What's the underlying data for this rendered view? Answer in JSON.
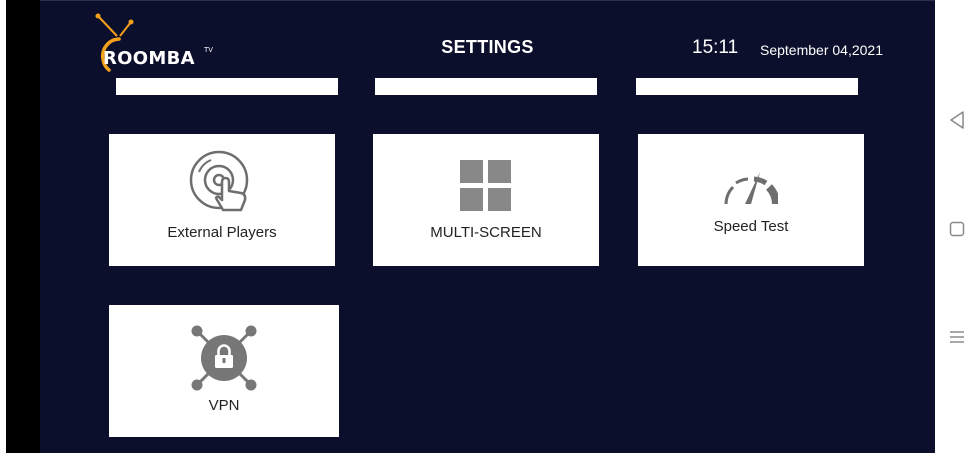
{
  "header": {
    "logo_text": "ROOMBA",
    "logo_superscript": "TV",
    "title": "SETTINGS",
    "time": "15:11",
    "date": "September 04,2021"
  },
  "tiles": [
    {
      "label": "External Players",
      "icon": "disc-touch-icon"
    },
    {
      "label": "MULTI-SCREEN",
      "icon": "grid-icon"
    },
    {
      "label": "Speed Test",
      "icon": "speedometer-icon"
    },
    {
      "label": "VPN",
      "icon": "vpn-lock-icon"
    }
  ],
  "system_nav": {
    "back_icon": "back-triangle-icon",
    "home_icon": "home-square-icon",
    "recents_icon": "recents-lines-icon"
  },
  "colors": {
    "app_background": "#0c0f2c",
    "logo_accent": "#f3a11c",
    "tile_background": "#ffffff",
    "icon_gray": "#6e6e6e"
  }
}
